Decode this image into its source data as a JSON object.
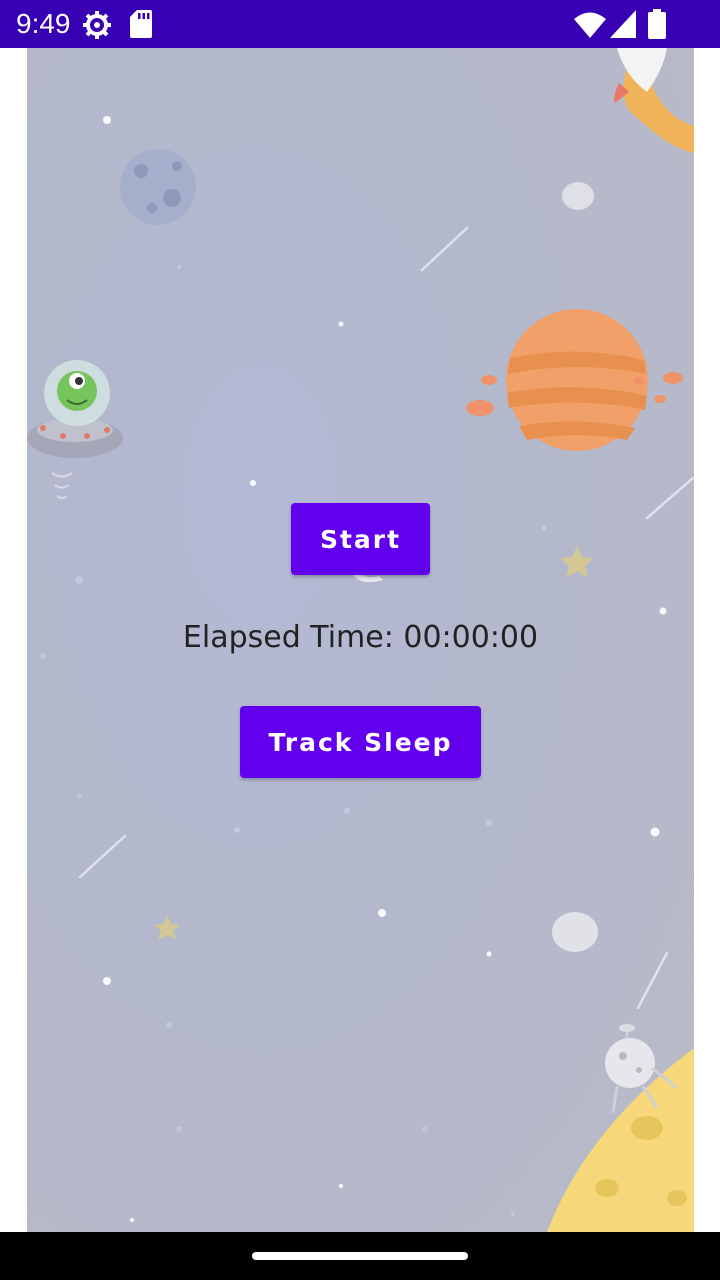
{
  "status_bar": {
    "time": "9:49",
    "icons": [
      "gear-icon",
      "sd-card-icon",
      "wifi-icon",
      "signal-icon",
      "battery-icon"
    ],
    "background": "#3700b3"
  },
  "main": {
    "start_button_label": "Start",
    "elapsed_time_text": "Elapsed Time: 00:00:00",
    "track_sleep_button_label": "Track Sleep",
    "button_color": "#6200ee",
    "background_illustration": "space scene with planets, alien spaceship, rocket, stars and moon"
  }
}
